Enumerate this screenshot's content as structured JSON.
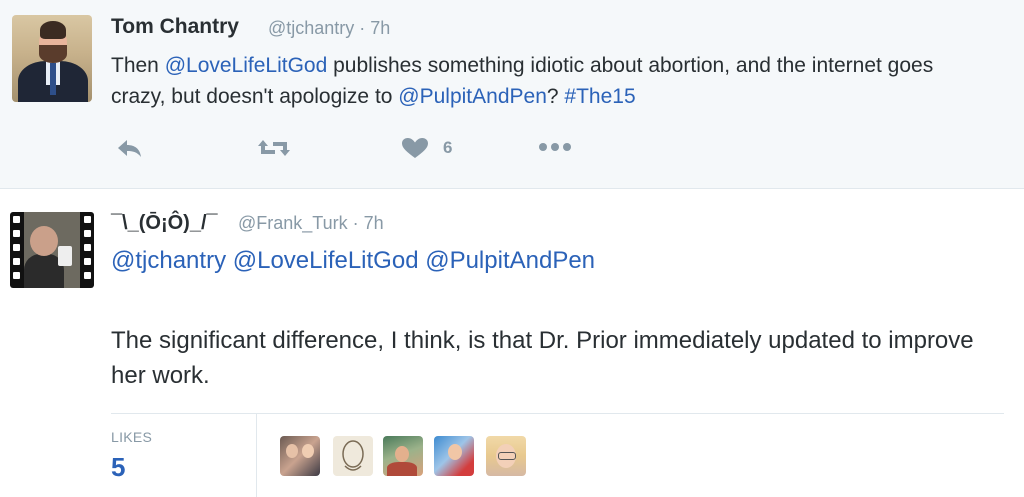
{
  "tweet1": {
    "name": "Tom Chantry",
    "handle_time": "@tjchantry · 7h",
    "text_parts": {
      "t1": "Then ",
      "m1": "@LoveLifeLitGod",
      "t2": " publishes something idiotic about abortion, and the internet goes crazy, but doesn't apologize to ",
      "m2": "@PulpitAndPen",
      "t3": "? ",
      "h1": "#The15"
    },
    "actions": {
      "reply_icon": "reply-icon",
      "retweet_icon": "retweet-icon",
      "like_icon": "heart-icon",
      "like_count": "6",
      "more_icon": "more-icon"
    }
  },
  "tweet2": {
    "name": "¯\\_(Ō¡Ô)_/¯",
    "handle_time": "@Frank_Turk · 7h",
    "mentions": "@tjchantry @LoveLifeLitGod @PulpitAndPen",
    "body": "The significant difference, I think, is that Dr. Prior immediately updated to improve her work.",
    "likes_label": "LIKES",
    "likes_count": "5"
  },
  "colors": {
    "link": "#2b62b8",
    "muted": "#8899a6",
    "text": "#292f33",
    "top_bg": "#f5f8fa"
  }
}
